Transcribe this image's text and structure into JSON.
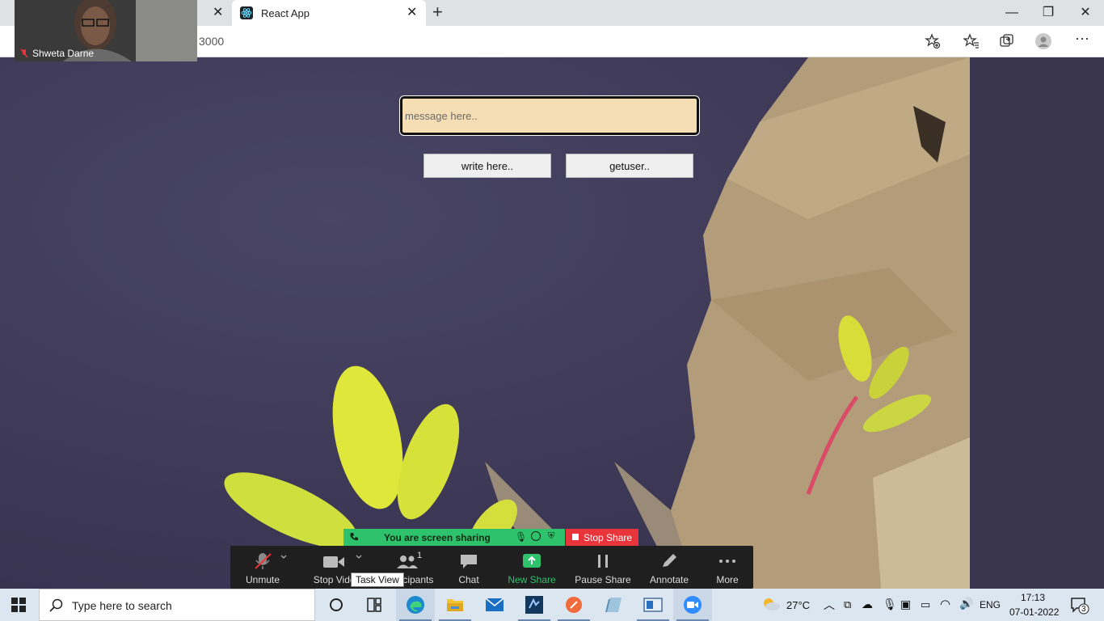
{
  "browser": {
    "active_tab": {
      "title": "React App"
    },
    "url_visible": "3000"
  },
  "app": {
    "message_placeholder": "message here..",
    "write_button": "write here..",
    "getuser_button": "getuser.."
  },
  "zoom": {
    "participant_name": "Shweta Darne",
    "share_banner": "You are screen sharing",
    "stop_share": "Stop Share",
    "participants_count": "1",
    "toolbar": [
      {
        "id": "unmute",
        "label": "Unmute"
      },
      {
        "id": "stop-video",
        "label": "Stop Video"
      },
      {
        "id": "participants",
        "label": "Participants"
      },
      {
        "id": "chat",
        "label": "Chat"
      },
      {
        "id": "new-share",
        "label": "New Share"
      },
      {
        "id": "pause-share",
        "label": "Pause Share"
      },
      {
        "id": "annotate",
        "label": "Annotate"
      },
      {
        "id": "more",
        "label": "More"
      }
    ]
  },
  "taskbar": {
    "search_placeholder": "Type here to search",
    "tooltip": "Task View",
    "weather": "27°C",
    "language": "ENG",
    "time": "17:13",
    "date": "07-01-2022",
    "notifications": "3"
  },
  "colors": {
    "input_bg": "#f5deb3",
    "share_green": "#2ec26c",
    "stop_red": "#e8343a"
  }
}
